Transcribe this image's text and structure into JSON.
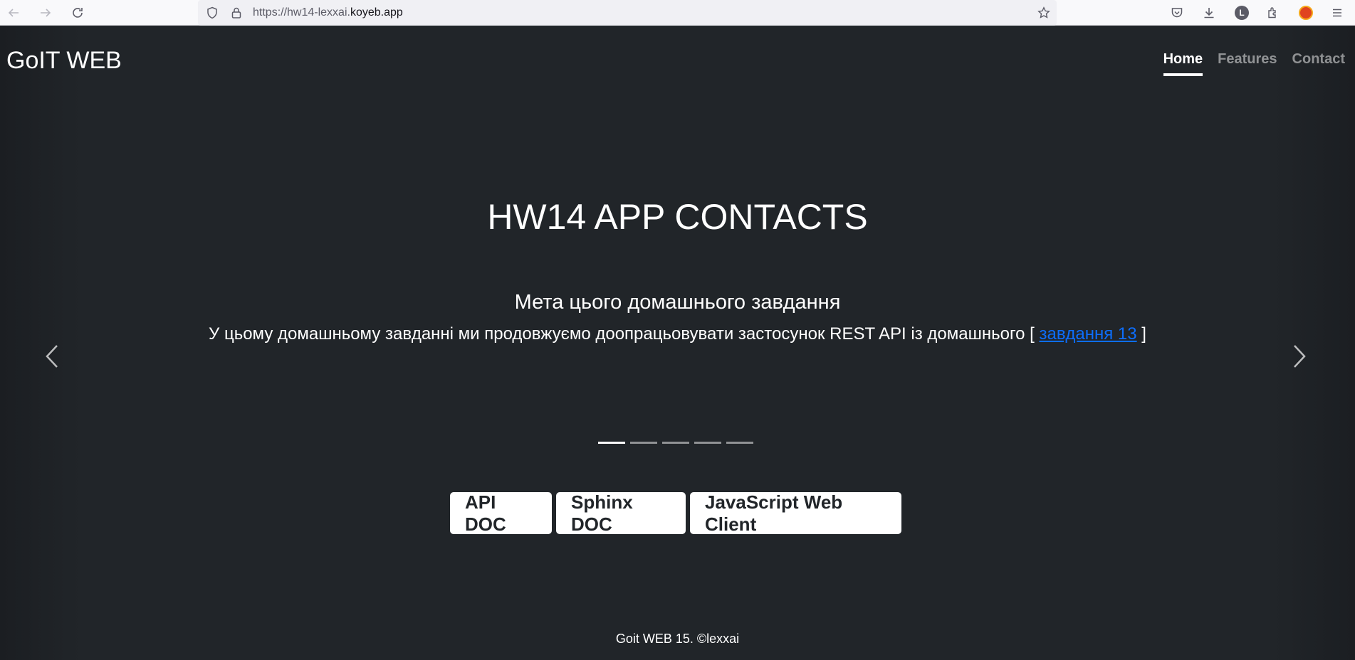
{
  "browser": {
    "url_prefix": "https://hw14-lexxai.",
    "url_domain": "koyeb.app",
    "profile_initial": "L",
    "icons": [
      "back-icon",
      "forward-icon",
      "reload-icon",
      "shield-icon",
      "lock-icon",
      "star-icon",
      "pocket-icon",
      "download-icon",
      "avatar",
      "extensions-icon",
      "addon-icon",
      "menu-icon"
    ]
  },
  "header": {
    "brand": "GoIT WEB",
    "nav": [
      {
        "label": "Home",
        "active": true
      },
      {
        "label": "Features",
        "active": false
      },
      {
        "label": "Contact",
        "active": false
      }
    ]
  },
  "hero": {
    "title": "HW14 APP CONTACTS"
  },
  "carousel": {
    "heading": "Мета цього домашнього завдання",
    "text_before": "У цьому домашньому завданні ми продовжуємо доопрацьовувати застосунок REST API із домашнього [ ",
    "link_text": "завдання 13",
    "text_after": " ]",
    "slide_count": 5,
    "active_slide": 1
  },
  "buttons": {
    "api_doc": "API DOC",
    "sphinx_doc": "Sphinx DOC",
    "js_client": "JavaScript Web Client"
  },
  "footer": {
    "text": "Goit WEB 15. ©lexxai"
  },
  "colors": {
    "page_bg": "#212529",
    "link": "#0d6efd"
  }
}
